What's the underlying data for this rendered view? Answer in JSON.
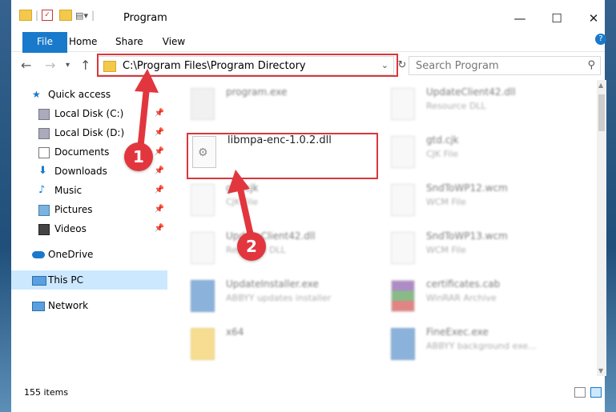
{
  "window": {
    "title": "Program"
  },
  "ribbon": {
    "tabs": [
      "File",
      "Home",
      "Share",
      "View"
    ]
  },
  "address": {
    "path": "C:\\Program Files\\Program Directory"
  },
  "search": {
    "placeholder": "Search Program"
  },
  "nav": {
    "quick_access": "Quick access",
    "items": [
      {
        "label": "Local Disk (C:)"
      },
      {
        "label": "Local Disk (D:)"
      },
      {
        "label": "Documents"
      },
      {
        "label": "Downloads"
      },
      {
        "label": "Music"
      },
      {
        "label": "Pictures"
      },
      {
        "label": "Videos"
      }
    ],
    "onedrive": "OneDrive",
    "this_pc": "This PC",
    "network": "Network"
  },
  "files": [
    {
      "name": "program.exe",
      "sub": ""
    },
    {
      "name": "UpdateClient42.dll",
      "sub": "Resource DLL"
    },
    {
      "name": "libmpa-enc-1.0.2.dll",
      "sub": ""
    },
    {
      "name": "gtd.cjk",
      "sub": "CJK File"
    },
    {
      "name": "gtd.cjk",
      "sub": "CJK File"
    },
    {
      "name": "SndToWP12.wcm",
      "sub": "WCM File"
    },
    {
      "name": "UpdateClient42.dll",
      "sub": "Resource DLL"
    },
    {
      "name": "SndToWP13.wcm",
      "sub": "WCM File"
    },
    {
      "name": "UpdateInstaller.exe",
      "sub": "ABBYY updates installer"
    },
    {
      "name": "certificates.cab",
      "sub": "WinRAR Archive"
    },
    {
      "name": "x64",
      "sub": ""
    },
    {
      "name": "FineExec.exe",
      "sub": "ABBYY background exe..."
    }
  ],
  "status": {
    "count": "155 items"
  },
  "annotations": {
    "badge1": "1",
    "badge2": "2"
  },
  "colors": {
    "accent": "#1979ca",
    "highlight": "#d9363e"
  }
}
